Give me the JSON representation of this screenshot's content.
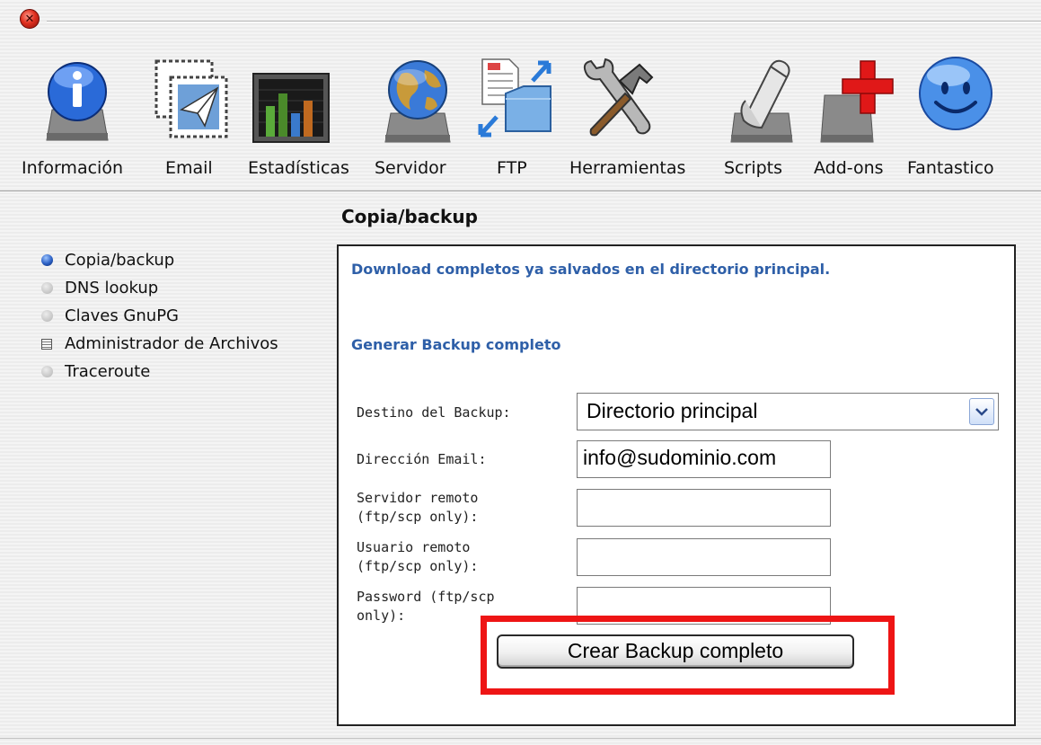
{
  "toolbar": {
    "items": [
      {
        "label": "Información",
        "icon": "info-icon"
      },
      {
        "label": "Email",
        "icon": "email-icon"
      },
      {
        "label": "Estadísticas",
        "icon": "stats-icon"
      },
      {
        "label": "Servidor",
        "icon": "server-globe-icon"
      },
      {
        "label": "FTP",
        "icon": "ftp-icon"
      },
      {
        "label": "Herramientas",
        "icon": "tools-icon"
      },
      {
        "label": "Scripts",
        "icon": "scripts-icon"
      },
      {
        "label": "Add-ons",
        "icon": "add-ons-icon"
      },
      {
        "label": "Fantastico",
        "icon": "smiley-icon"
      }
    ]
  },
  "sidebar": {
    "items": [
      {
        "label": "Copia/backup",
        "active": true
      },
      {
        "label": "DNS lookup"
      },
      {
        "label": "Claves GnuPG"
      },
      {
        "label": "Administrador de Archivos"
      },
      {
        "label": "Traceroute"
      }
    ]
  },
  "page": {
    "title": "Copia/backup"
  },
  "panel": {
    "download_link": "Download completos ya salvados en el directorio principal.",
    "generate_heading": "Generar Backup completo"
  },
  "form": {
    "destino_label": "Destino del Backup:",
    "destino_value": "Directorio principal",
    "email_label": "Dirección Email:",
    "email_value": "info@sudominio.com",
    "servidor_label_1": "Servidor remoto",
    "servidor_label_2": "(ftp/scp only):",
    "usuario_label_1": "Usuario remoto",
    "usuario_label_2": "(ftp/scp only):",
    "password_label_1": "Password (ftp/scp",
    "password_label_2": "only):",
    "submit_label": "Crear Backup completo"
  },
  "colors": {
    "link": "#2e5fa8",
    "highlight": "#ee1515"
  }
}
